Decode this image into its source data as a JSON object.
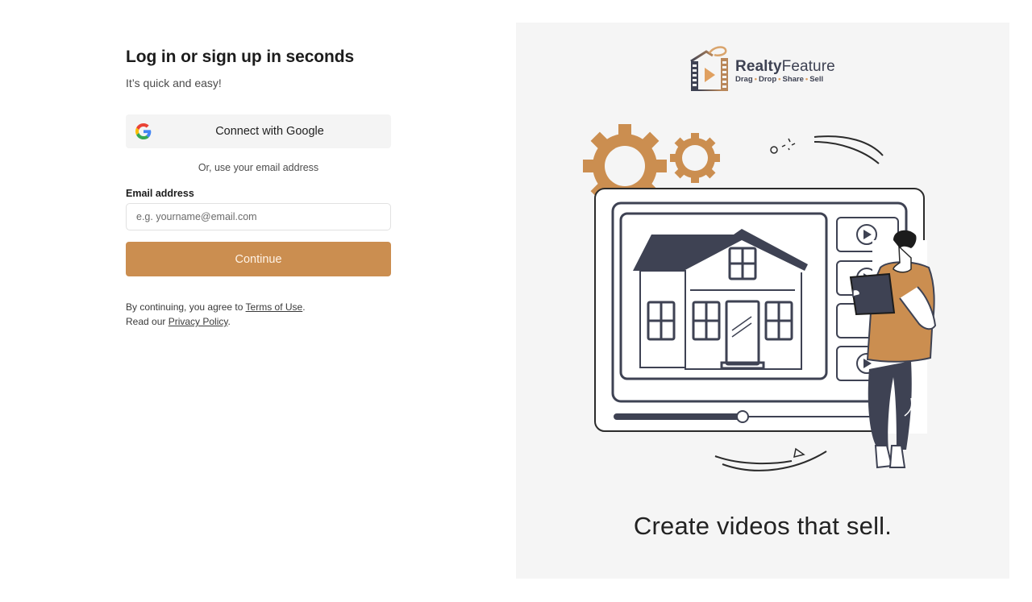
{
  "auth": {
    "title": "Log in or sign up in seconds",
    "subtitle": "It’s quick and easy!",
    "google_button": "Connect with Google",
    "divider": "Or, use your email address",
    "email_label": "Email address",
    "email_placeholder": "e.g. yourname@email.com",
    "email_value": "",
    "continue_button": "Continue",
    "legal": {
      "terms_prefix": "By continuing, you agree to ",
      "terms_link": "Terms of Use",
      "terms_suffix": ".",
      "privacy_prefix": "Read our ",
      "privacy_link": "Privacy Policy",
      "privacy_suffix": "."
    }
  },
  "promo": {
    "brand_bold": "Realty",
    "brand_light": "Feature",
    "tagline": [
      "Drag",
      "Drop",
      "Share",
      "Sell"
    ],
    "caption": "Create videos that sell."
  },
  "colors": {
    "accent": "#cb8e50",
    "illustration_dark": "#3e4253",
    "panel_bg": "#f5f5f5"
  }
}
